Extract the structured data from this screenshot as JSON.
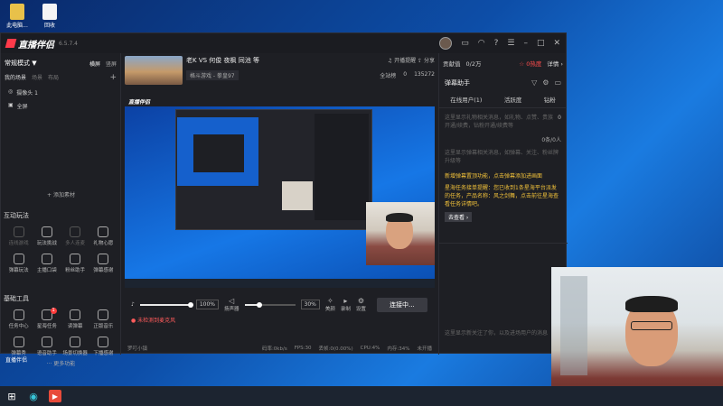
{
  "desktop": {
    "icons": [
      {
        "label": "此电脑...",
        "icon": "folder-icon"
      },
      {
        "label": "回收",
        "icon": "file-icon"
      }
    ],
    "bottom_label": "直播伴侣"
  },
  "app": {
    "name": "直播伴侣",
    "version": "6.5.7.4"
  },
  "left": {
    "mode_label": "常规模式 ▼",
    "orientation": {
      "landscape": "横屏",
      "portrait": "竖屏"
    },
    "tabs": [
      "我的场景",
      "场景",
      "布局"
    ],
    "scenes": [
      {
        "label": "摄像头 1",
        "icon": "camera-icon"
      },
      {
        "label": "全屏",
        "icon": "screen-icon"
      }
    ],
    "add_source": "+ 添加素材",
    "interactive_title": "互动玩法",
    "interactive": [
      {
        "label": "连线游戏",
        "dim": true
      },
      {
        "label": "玩法挑战",
        "dim": false
      },
      {
        "label": "多人连麦",
        "dim": true
      },
      {
        "label": "礼物心愿",
        "dim": false
      },
      {
        "label": "弹幕玩法",
        "dim": false
      },
      {
        "label": "主播口袋",
        "dim": false
      },
      {
        "label": "粉丝助手",
        "dim": false
      },
      {
        "label": "弹幕感谢",
        "dim": false
      }
    ],
    "tools_title": "基础工具",
    "tools": [
      {
        "label": "任务中心",
        "badge": ""
      },
      {
        "label": "星海任务",
        "badge": "1"
      },
      {
        "label": "读弹幕",
        "badge": ""
      },
      {
        "label": "正版音乐",
        "badge": ""
      },
      {
        "label": "弹幕秀",
        "badge": ""
      },
      {
        "label": "语音助手",
        "badge": ""
      },
      {
        "label": "场景切换器",
        "badge": ""
      },
      {
        "label": "下播感谢",
        "badge": ""
      }
    ],
    "more": "··· 更多功能"
  },
  "room": {
    "title": "老K VS 何俊 夜枫 同池 等",
    "category": "格斗游戏 - 拳皇97",
    "notice": "开播提醒",
    "share": "分享",
    "audience": "全站榜",
    "likes": "0",
    "hearts": "135272"
  },
  "controls": {
    "mic_pct": "100%",
    "speaker_label": "扬声器",
    "speaker_pct": "30%",
    "icons": [
      {
        "label": "美颜",
        "glyph": "✧"
      },
      {
        "label": "录制",
        "glyph": "▸"
      },
      {
        "label": "设置",
        "glyph": "⚙"
      }
    ],
    "connect": "连接中...",
    "mic_warn": "● 未检测到麦克风"
  },
  "status": {
    "player": "罗叮小镇",
    "bitrate": "码率:0kb/s",
    "fps": "FPS:30",
    "drop": "丢帧:0(0.00%)",
    "cpu": "CPU:4%",
    "mem": "内存:34%",
    "live": "未开播"
  },
  "right": {
    "contribution": "贡献值",
    "coins": "0/2万",
    "hot": "☆ 0热度",
    "detail": "详情 ›",
    "assist_title": "弹幕助手",
    "tabs": [
      "在线用户(1)",
      "活跃度",
      "钻粉"
    ],
    "top_placeholder": "这里显示礼物相关消息，如礼物、点赞、贵族开通/续费，钻粉开通/续费等",
    "top_count": "0",
    "count_tag": "0条/0人",
    "mid_placeholder": "这里显示弹幕相关消息，如弹幕、关注、粉丝牌升级等",
    "yellow1": "新增弹幕置顶功能，点击弹幕添加进画面",
    "yellow2": "星海任务接单提醒：您已收到1条星海平台派发的任务，产品名称：风之剑舞，点击前往星海查看任务详情吧。",
    "go": "去查看 ›",
    "bottom_placeholder": "这里显示新关注了你，以及进场用户的消息"
  }
}
